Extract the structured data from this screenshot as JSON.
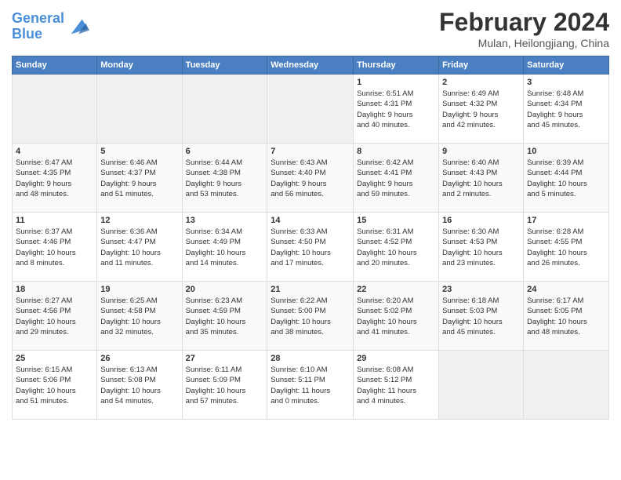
{
  "logo": {
    "line1": "General",
    "line2": "Blue",
    "icon_color": "#4a90d9"
  },
  "title": "February 2024",
  "subtitle": "Mulan, Heilongjiang, China",
  "days_of_week": [
    "Sunday",
    "Monday",
    "Tuesday",
    "Wednesday",
    "Thursday",
    "Friday",
    "Saturday"
  ],
  "weeks": [
    [
      {
        "num": "",
        "info": ""
      },
      {
        "num": "",
        "info": ""
      },
      {
        "num": "",
        "info": ""
      },
      {
        "num": "",
        "info": ""
      },
      {
        "num": "1",
        "info": "Sunrise: 6:51 AM\nSunset: 4:31 PM\nDaylight: 9 hours\nand 40 minutes."
      },
      {
        "num": "2",
        "info": "Sunrise: 6:49 AM\nSunset: 4:32 PM\nDaylight: 9 hours\nand 42 minutes."
      },
      {
        "num": "3",
        "info": "Sunrise: 6:48 AM\nSunset: 4:34 PM\nDaylight: 9 hours\nand 45 minutes."
      }
    ],
    [
      {
        "num": "4",
        "info": "Sunrise: 6:47 AM\nSunset: 4:35 PM\nDaylight: 9 hours\nand 48 minutes."
      },
      {
        "num": "5",
        "info": "Sunrise: 6:46 AM\nSunset: 4:37 PM\nDaylight: 9 hours\nand 51 minutes."
      },
      {
        "num": "6",
        "info": "Sunrise: 6:44 AM\nSunset: 4:38 PM\nDaylight: 9 hours\nand 53 minutes."
      },
      {
        "num": "7",
        "info": "Sunrise: 6:43 AM\nSunset: 4:40 PM\nDaylight: 9 hours\nand 56 minutes."
      },
      {
        "num": "8",
        "info": "Sunrise: 6:42 AM\nSunset: 4:41 PM\nDaylight: 9 hours\nand 59 minutes."
      },
      {
        "num": "9",
        "info": "Sunrise: 6:40 AM\nSunset: 4:43 PM\nDaylight: 10 hours\nand 2 minutes."
      },
      {
        "num": "10",
        "info": "Sunrise: 6:39 AM\nSunset: 4:44 PM\nDaylight: 10 hours\nand 5 minutes."
      }
    ],
    [
      {
        "num": "11",
        "info": "Sunrise: 6:37 AM\nSunset: 4:46 PM\nDaylight: 10 hours\nand 8 minutes."
      },
      {
        "num": "12",
        "info": "Sunrise: 6:36 AM\nSunset: 4:47 PM\nDaylight: 10 hours\nand 11 minutes."
      },
      {
        "num": "13",
        "info": "Sunrise: 6:34 AM\nSunset: 4:49 PM\nDaylight: 10 hours\nand 14 minutes."
      },
      {
        "num": "14",
        "info": "Sunrise: 6:33 AM\nSunset: 4:50 PM\nDaylight: 10 hours\nand 17 minutes."
      },
      {
        "num": "15",
        "info": "Sunrise: 6:31 AM\nSunset: 4:52 PM\nDaylight: 10 hours\nand 20 minutes."
      },
      {
        "num": "16",
        "info": "Sunrise: 6:30 AM\nSunset: 4:53 PM\nDaylight: 10 hours\nand 23 minutes."
      },
      {
        "num": "17",
        "info": "Sunrise: 6:28 AM\nSunset: 4:55 PM\nDaylight: 10 hours\nand 26 minutes."
      }
    ],
    [
      {
        "num": "18",
        "info": "Sunrise: 6:27 AM\nSunset: 4:56 PM\nDaylight: 10 hours\nand 29 minutes."
      },
      {
        "num": "19",
        "info": "Sunrise: 6:25 AM\nSunset: 4:58 PM\nDaylight: 10 hours\nand 32 minutes."
      },
      {
        "num": "20",
        "info": "Sunrise: 6:23 AM\nSunset: 4:59 PM\nDaylight: 10 hours\nand 35 minutes."
      },
      {
        "num": "21",
        "info": "Sunrise: 6:22 AM\nSunset: 5:00 PM\nDaylight: 10 hours\nand 38 minutes."
      },
      {
        "num": "22",
        "info": "Sunrise: 6:20 AM\nSunset: 5:02 PM\nDaylight: 10 hours\nand 41 minutes."
      },
      {
        "num": "23",
        "info": "Sunrise: 6:18 AM\nSunset: 5:03 PM\nDaylight: 10 hours\nand 45 minutes."
      },
      {
        "num": "24",
        "info": "Sunrise: 6:17 AM\nSunset: 5:05 PM\nDaylight: 10 hours\nand 48 minutes."
      }
    ],
    [
      {
        "num": "25",
        "info": "Sunrise: 6:15 AM\nSunset: 5:06 PM\nDaylight: 10 hours\nand 51 minutes."
      },
      {
        "num": "26",
        "info": "Sunrise: 6:13 AM\nSunset: 5:08 PM\nDaylight: 10 hours\nand 54 minutes."
      },
      {
        "num": "27",
        "info": "Sunrise: 6:11 AM\nSunset: 5:09 PM\nDaylight: 10 hours\nand 57 minutes."
      },
      {
        "num": "28",
        "info": "Sunrise: 6:10 AM\nSunset: 5:11 PM\nDaylight: 11 hours\nand 0 minutes."
      },
      {
        "num": "29",
        "info": "Sunrise: 6:08 AM\nSunset: 5:12 PM\nDaylight: 11 hours\nand 4 minutes."
      },
      {
        "num": "",
        "info": ""
      },
      {
        "num": "",
        "info": ""
      }
    ]
  ]
}
